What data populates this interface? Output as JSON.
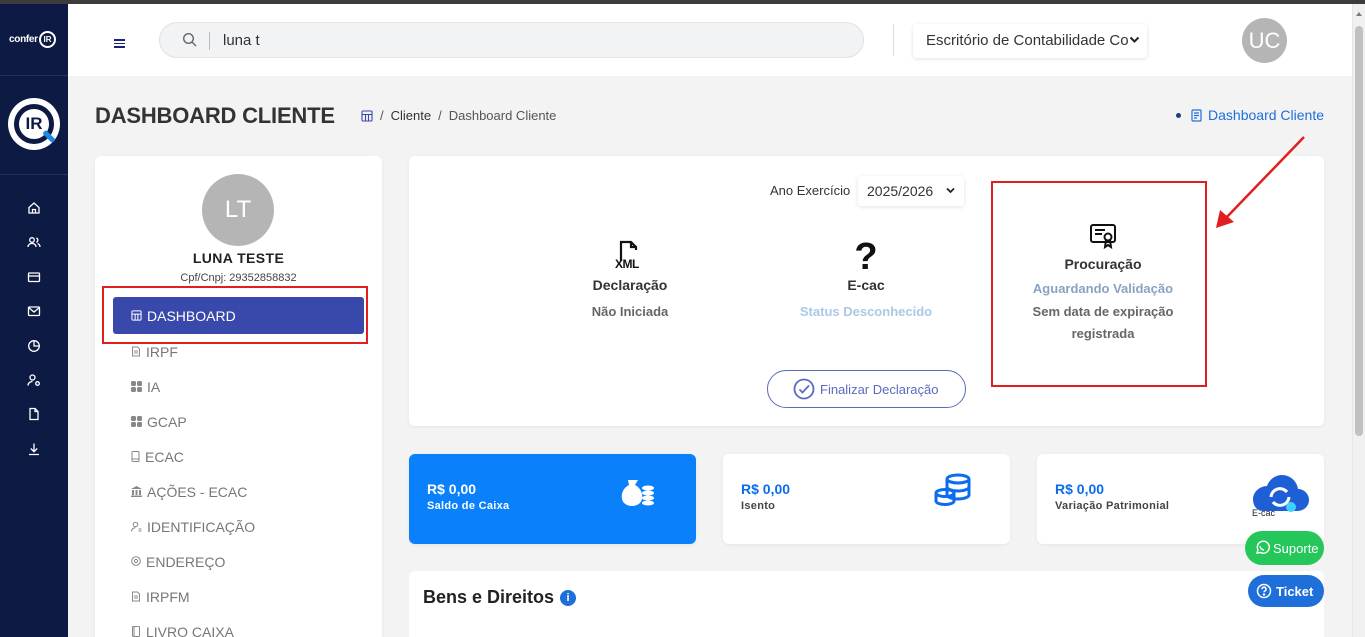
{
  "brand": {
    "text": "confer",
    "badge": "IR",
    "logo_text": "IR"
  },
  "sidebar": {
    "icons": [
      "home-icon",
      "users-icon",
      "card-icon",
      "mail-icon",
      "pie-chart-icon",
      "user-gear-icon",
      "document-icon",
      "download-icon"
    ]
  },
  "topbar": {
    "search_value": "luna t",
    "office_select": "Escritório de Contabilidade Co",
    "user_initials": "UC"
  },
  "page": {
    "title": "DASHBOARD CLIENTE",
    "breadcrumb": [
      "Cliente",
      "Dashboard Cliente"
    ],
    "right_link": "Dashboard Cliente"
  },
  "client": {
    "initials": "LT",
    "name": "LUNA TESTE",
    "cpf": "Cpf/Cnpj: 29352858832"
  },
  "menu": {
    "active": "DASHBOARD",
    "items": [
      "IRPF",
      "IA",
      "GCAP",
      "ECAC",
      "AÇÕES - ECAC",
      "IDENTIFICAÇÃO",
      "ENDEREÇO",
      "IRPFM",
      "LIVRO CAIXA"
    ]
  },
  "status": {
    "year_label": "Ano Exercício",
    "year_value": "2025/2026",
    "declaracao": {
      "title": "Declaração",
      "sub": "Não Iniciada",
      "icon_text": "XML"
    },
    "ecac": {
      "title": "E-cac",
      "sub": "Status Desconhecido",
      "icon_text": "?"
    },
    "procuracao": {
      "title": "Procuração",
      "sub": "Aguardando Validação",
      "note": "Sem data de expiração registrada"
    },
    "finalize_label": "Finalizar Declaração"
  },
  "stats": [
    {
      "value": "R$ 0,00",
      "label": "Saldo de Caixa"
    },
    {
      "value": "R$ 0,00",
      "label": "Isento"
    },
    {
      "value": "R$ 0,00",
      "label": "Variação Patrimonial",
      "badge": "E-cac"
    }
  ],
  "bens": {
    "title": "Bens e Direitos",
    "info": "i"
  },
  "floating": {
    "suporte": "Suporte",
    "ticket": "Ticket"
  },
  "colors": {
    "sidebar": "#0d1a44",
    "accent": "#3949ab",
    "primary": "#0b80fb",
    "annotation": "#e02020"
  }
}
